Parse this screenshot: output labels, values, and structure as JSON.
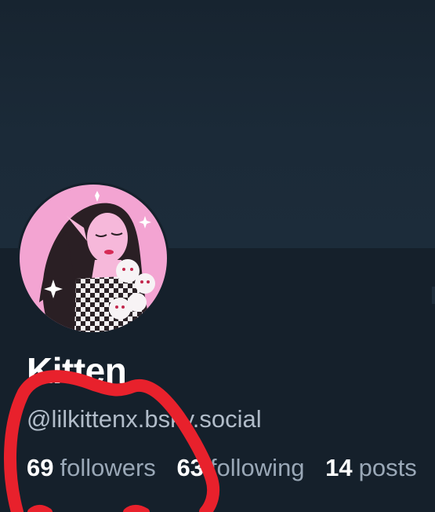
{
  "profile": {
    "display_name": "Kitten",
    "handle": "@lilkittenx.bsky.social"
  },
  "stats": {
    "followers": {
      "count": "69",
      "label": "followers"
    },
    "following": {
      "count": "63",
      "label": "following"
    },
    "posts": {
      "count": "14",
      "label": "posts"
    }
  },
  "colors": {
    "background": "#15202b",
    "banner": "#1b2a38",
    "text_primary": "#ffffff",
    "text_secondary": "#9aa8b7",
    "avatar_pink": "#f2a5d1",
    "annotation_red": "#e8212c"
  }
}
